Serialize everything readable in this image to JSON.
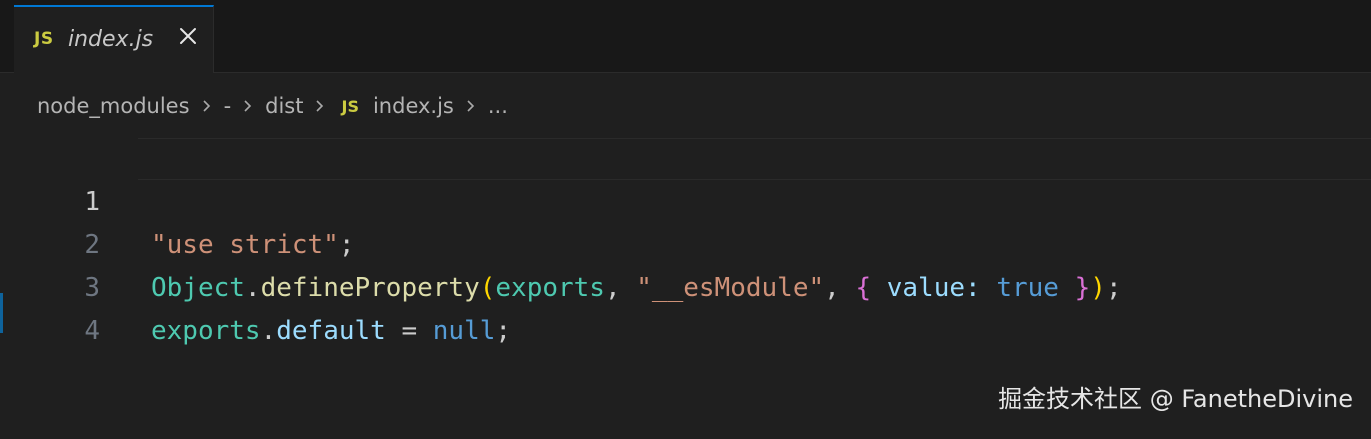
{
  "tab": {
    "icon_text": "JS",
    "filename": "index.js"
  },
  "breadcrumb": {
    "items": [
      "node_modules",
      "-",
      "dist"
    ],
    "file_icon_text": "JS",
    "file": "index.js",
    "overflow": "..."
  },
  "editor": {
    "line_numbers": [
      "1",
      "2",
      "3",
      "4"
    ],
    "lines": [
      [
        {
          "text": "\"use strict\"",
          "kind": "str"
        },
        {
          "text": ";",
          "kind": "plain"
        }
      ],
      [
        {
          "text": "Object",
          "kind": "type"
        },
        {
          "text": ".",
          "kind": "plain"
        },
        {
          "text": "defineProperty",
          "kind": "fn"
        },
        {
          "text": "(",
          "kind": "br1"
        },
        {
          "text": "exports",
          "kind": "type"
        },
        {
          "text": ", ",
          "kind": "plain"
        },
        {
          "text": "\"__esModule\"",
          "kind": "str"
        },
        {
          "text": ", ",
          "kind": "plain"
        },
        {
          "text": "{",
          "kind": "br2"
        },
        {
          "text": " ",
          "kind": "plain"
        },
        {
          "text": "value",
          "kind": "var"
        },
        {
          "text": ": ",
          "kind": "var"
        },
        {
          "text": "true",
          "kind": "kw"
        },
        {
          "text": " ",
          "kind": "plain"
        },
        {
          "text": "}",
          "kind": "br2"
        },
        {
          "text": ")",
          "kind": "br1"
        },
        {
          "text": ";",
          "kind": "plain"
        }
      ],
      [
        {
          "text": "exports",
          "kind": "type"
        },
        {
          "text": ".",
          "kind": "plain"
        },
        {
          "text": "default",
          "kind": "var"
        },
        {
          "text": " = ",
          "kind": "plain"
        },
        {
          "text": "null",
          "kind": "kw"
        },
        {
          "text": ";",
          "kind": "plain"
        }
      ],
      []
    ]
  },
  "watermark": "掘金技术社区 @ FanetheDivine",
  "colors": {
    "background": "#1f1f1f",
    "tab_accent": "#0078d4",
    "js_icon": "#cbcb41"
  }
}
